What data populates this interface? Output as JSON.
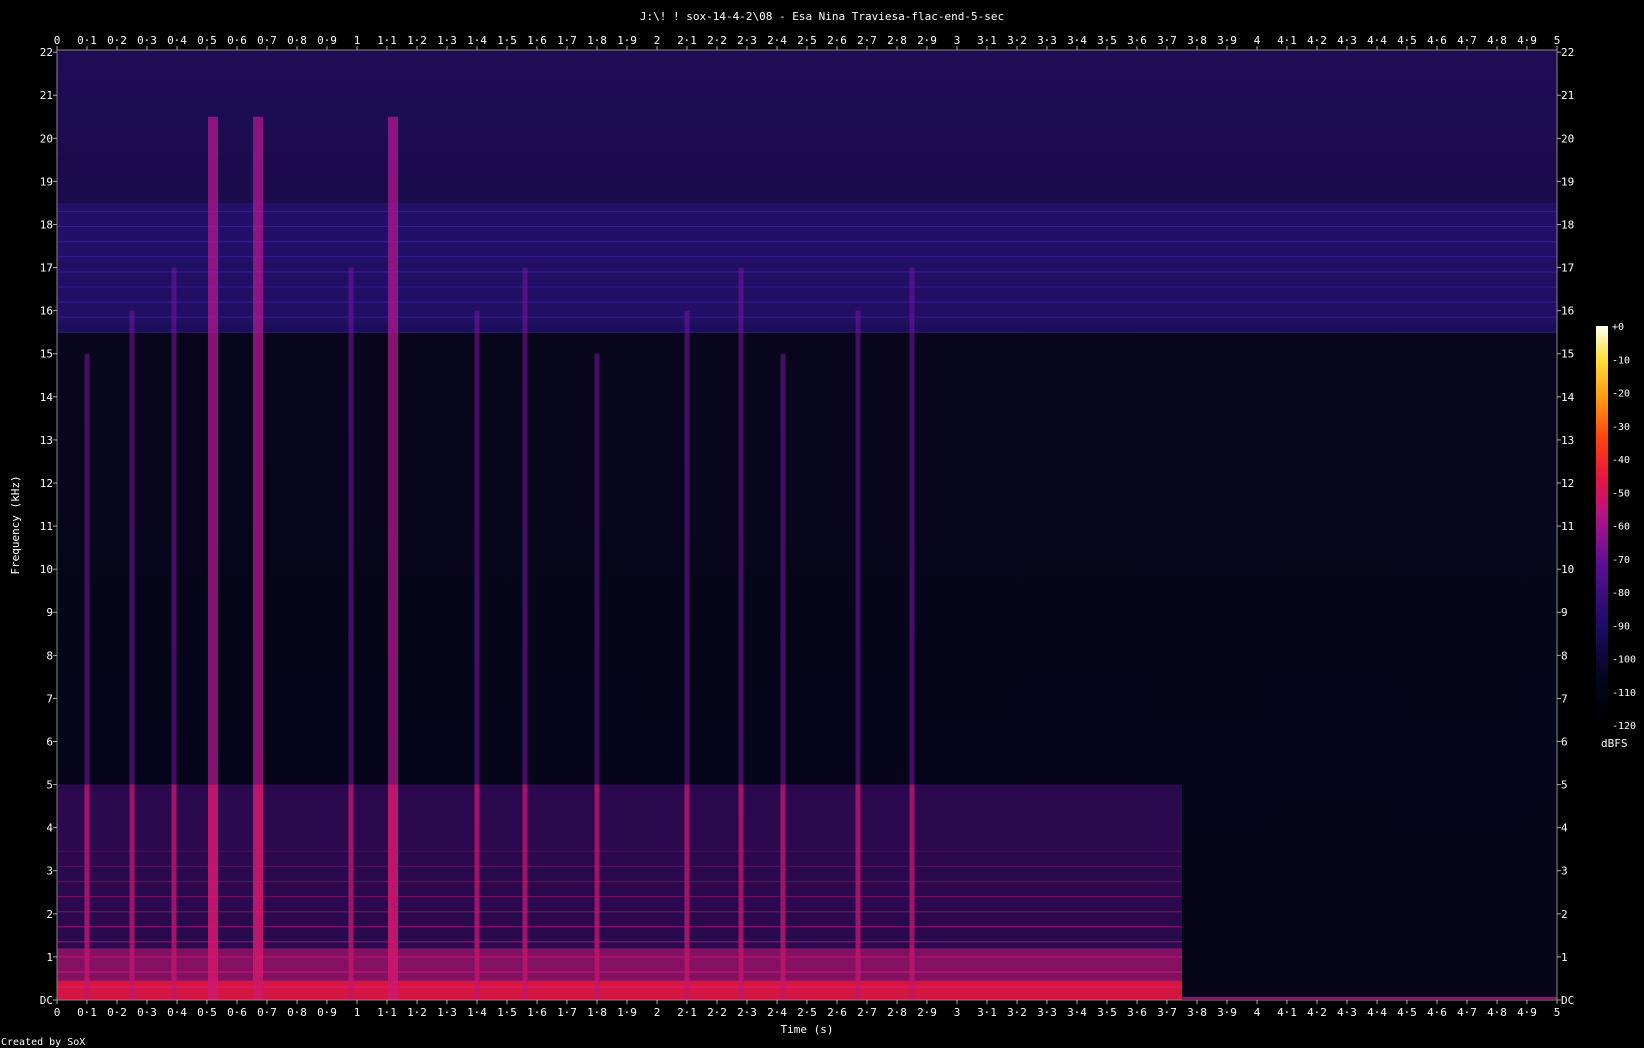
{
  "chart_data": {
    "type": "heatmap",
    "title": "J:\\! ! sox-14-4-2\\08 - Esa Nina Traviesa-flac-end-5-sec",
    "xlabel": "Time (s)",
    "ylabel": "Frequency (kHz)",
    "footer": "Created by SoX",
    "xlim": [
      0,
      5
    ],
    "ylim": [
      0,
      22.05
    ],
    "x_ticks": [
      "0",
      "0·1",
      "0·2",
      "0·3",
      "0·4",
      "0·5",
      "0·6",
      "0·7",
      "0·8",
      "0·9",
      "1",
      "1·1",
      "1·2",
      "1·3",
      "1·4",
      "1·5",
      "1·6",
      "1·7",
      "1·8",
      "1·9",
      "2",
      "2·1",
      "2·2",
      "2·3",
      "2·4",
      "2·5",
      "2·6",
      "2·7",
      "2·8",
      "2·9",
      "3",
      "3·1",
      "3·2",
      "3·3",
      "3·4",
      "3·5",
      "3·6",
      "3·7",
      "3·8",
      "3·9",
      "4",
      "4·1",
      "4·2",
      "4·3",
      "4·4",
      "4·5",
      "4·6",
      "4·7",
      "4·8",
      "4·9",
      "5"
    ],
    "y_ticks": [
      "DC",
      "1",
      "2",
      "3",
      "4",
      "5",
      "6",
      "7",
      "8",
      "9",
      "10",
      "11",
      "12",
      "13",
      "14",
      "15",
      "16",
      "17",
      "18",
      "19",
      "20",
      "21",
      "22"
    ],
    "colorbar": {
      "unit": "dBFS",
      "range": [
        -120,
        0
      ],
      "ticks": [
        "+0",
        "-10",
        "-20",
        "-30",
        "-40",
        "-50",
        "-60",
        "-70",
        "-80",
        "-90",
        "-100",
        "-110",
        "-120"
      ]
    },
    "transients_s": [
      0.1,
      0.25,
      0.39,
      0.52,
      0.67,
      0.98,
      1.12,
      1.4,
      1.56,
      1.8,
      2.1,
      2.28,
      2.42,
      2.67,
      2.85
    ],
    "sound_end_s": 3.75,
    "noise_band_khz": [
      15.5,
      18.5
    ]
  }
}
